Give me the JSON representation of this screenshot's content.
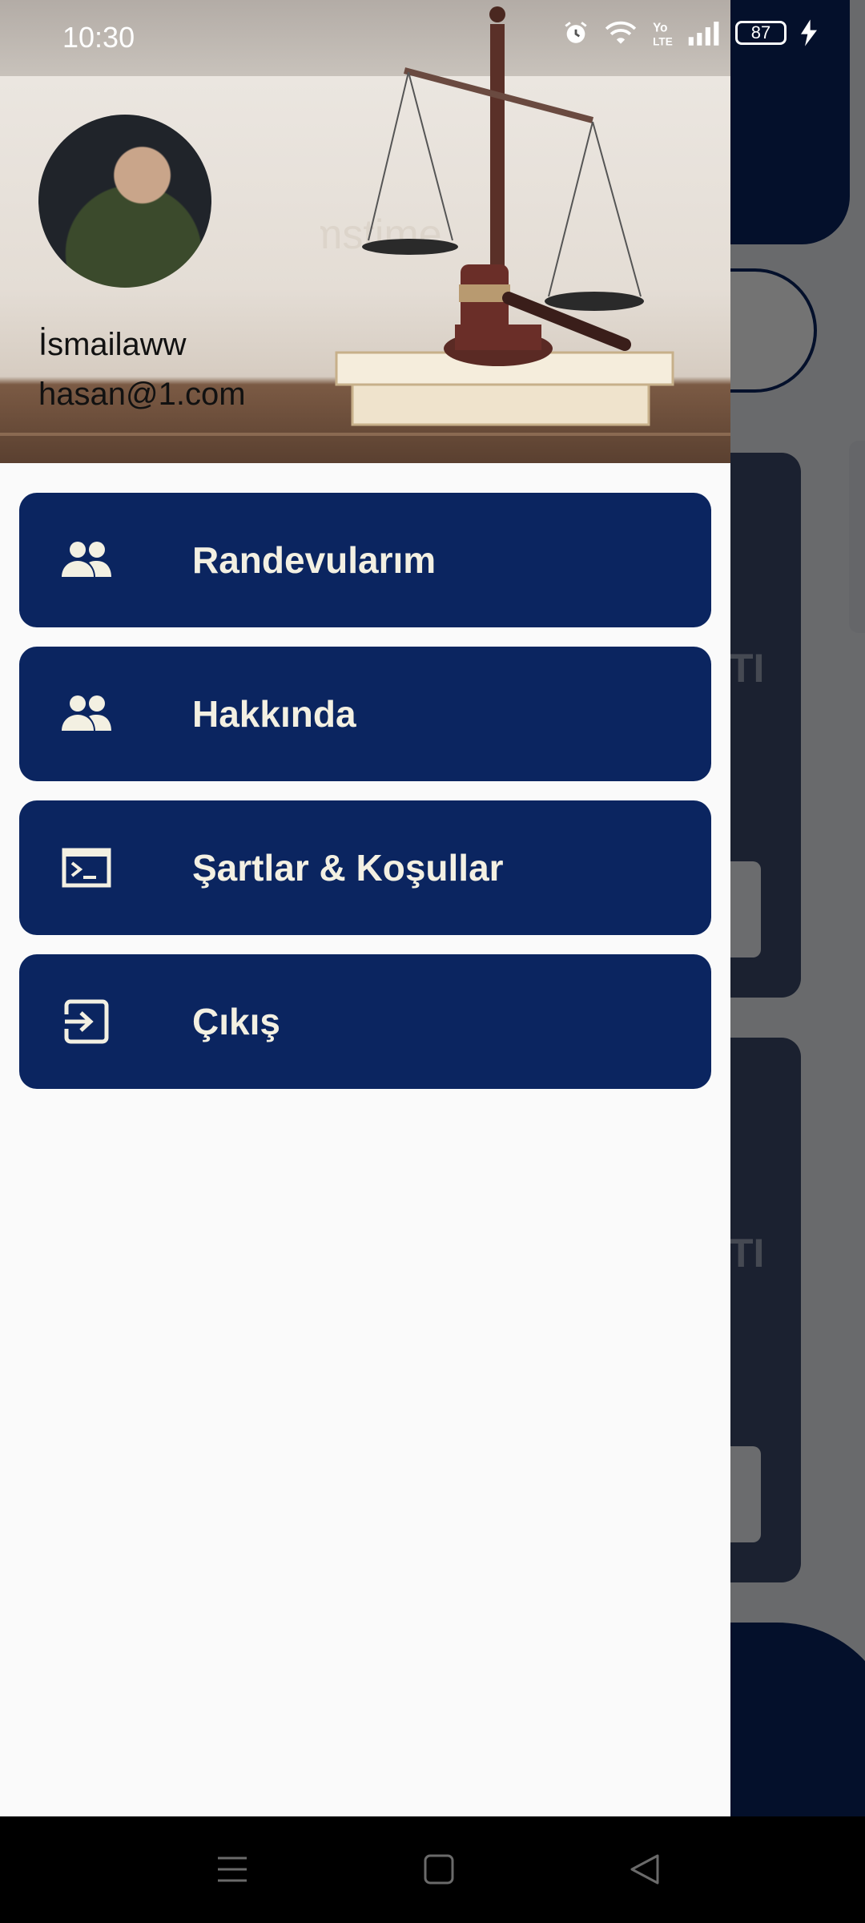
{
  "status": {
    "time": "10:30",
    "battery": "87",
    "icons": [
      "alarm-icon",
      "wifi-icon",
      "volte-icon",
      "signal-icon",
      "battery-icon",
      "charging-icon"
    ]
  },
  "background": {
    "card_text": "TI"
  },
  "drawer": {
    "user": {
      "name": "İsmailaww",
      "email": "hasan@1.com"
    },
    "watermark": "dreamstime",
    "menu": [
      {
        "label": "Randevularım",
        "icon": "people-icon"
      },
      {
        "label": "Hakkında",
        "icon": "people-icon"
      },
      {
        "label": "Şartlar & Koşullar",
        "icon": "terminal-icon"
      },
      {
        "label": "Çıkış",
        "icon": "exit-icon"
      }
    ]
  },
  "colors": {
    "primary": "#0b2560",
    "label": "#f3f0e2",
    "drawer_bg": "#fafafa"
  },
  "navbar": {
    "buttons": [
      "menu-icon",
      "home-icon",
      "back-icon"
    ]
  }
}
